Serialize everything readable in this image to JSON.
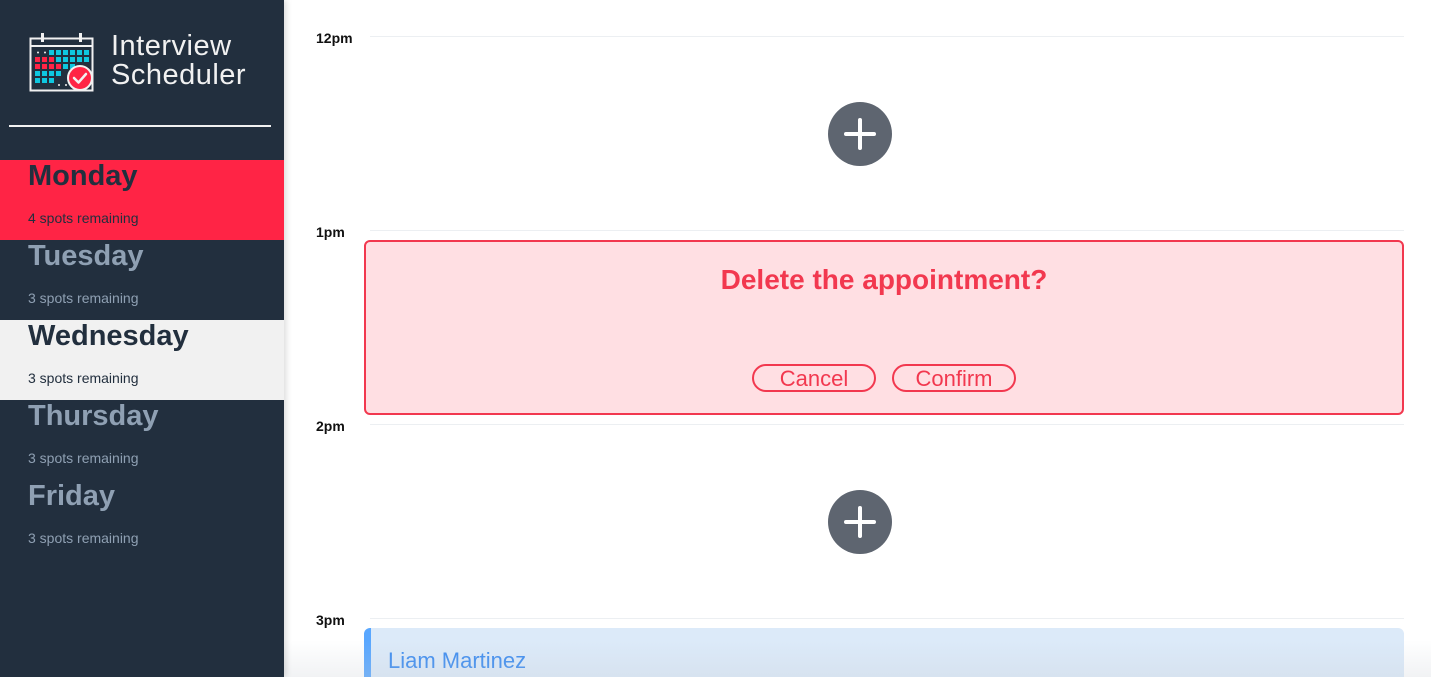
{
  "brand": {
    "title_line1": "Interview",
    "title_line2": "Scheduler",
    "logo_icon": "calendar-check-icon"
  },
  "days": [
    {
      "name": "Monday",
      "spots": "4 spots remaining",
      "state": "selected"
    },
    {
      "name": "Tuesday",
      "spots": "3 spots remaining",
      "state": "normal"
    },
    {
      "name": "Wednesday",
      "spots": "3 spots remaining",
      "state": "hover"
    },
    {
      "name": "Thursday",
      "spots": "3 spots remaining",
      "state": "normal"
    },
    {
      "name": "Friday",
      "spots": "3 spots remaining",
      "state": "normal"
    }
  ],
  "schedule": {
    "times": [
      "12pm",
      "1pm",
      "2pm",
      "3pm"
    ],
    "add_icon": "plus-icon",
    "confirm": {
      "message": "Delete the appointment?",
      "cancel_label": "Cancel",
      "confirm_label": "Confirm"
    },
    "appointment": {
      "student": "Liam Martinez"
    }
  },
  "colors": {
    "sidebar_bg": "#222f3e",
    "selected_day": "#ff2445",
    "hover_day": "#f1f1f1",
    "confirm_accent": "#f2384f",
    "confirm_bg": "#ffdfe3",
    "appointment_accent": "#59a7ff",
    "appointment_bg": "#dceaf9",
    "add_button": "#5e6570"
  }
}
